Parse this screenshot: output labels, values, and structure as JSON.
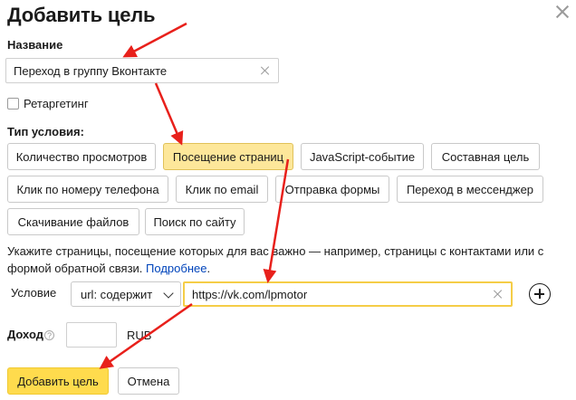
{
  "dialog": {
    "title": "Добавить цель",
    "name_label": "Название",
    "name_value": "Переход в группу Вконтакте",
    "retargeting_label": "Ретаргетинг",
    "condition_type_label": "Тип условия:",
    "condition_types": [
      {
        "label": "Количество просмотров",
        "active": false
      },
      {
        "label": "Посещение страниц",
        "active": true
      },
      {
        "label": "JavaScript-событие",
        "active": false
      },
      {
        "label": "Составная цель",
        "active": false
      },
      {
        "label": "Клик по номеру телефона",
        "active": false
      },
      {
        "label": "Клик по email",
        "active": false
      },
      {
        "label": "Отправка формы",
        "active": false
      },
      {
        "label": "Переход в мессенджер",
        "active": false
      },
      {
        "label": "Скачивание файлов",
        "active": false
      },
      {
        "label": "Поиск по сайту",
        "active": false
      }
    ],
    "description_text": "Укажите страницы, посещение которых для вас важно — например, страницы с контактами или с формой обратной связи.",
    "description_link": "Подробнее",
    "description_end": ".",
    "condition_label": "Условие",
    "condition_select_value": "url: содержит",
    "condition_url_value": "https://vk.com/lpmotor",
    "income_label": "Доход",
    "income_value": "",
    "income_currency": "RUB",
    "submit_label": "Добавить цель",
    "cancel_label": "Отмена"
  },
  "colors": {
    "accent_yellow": "#ffdb4d",
    "active_chip": "#fde79a",
    "link": "#0044bb",
    "annotation_arrow": "#e8201b"
  },
  "icons": [
    "close-icon",
    "clear-icon",
    "chevron-down-icon",
    "plus-icon",
    "help-icon",
    "annotation-arrow"
  ]
}
